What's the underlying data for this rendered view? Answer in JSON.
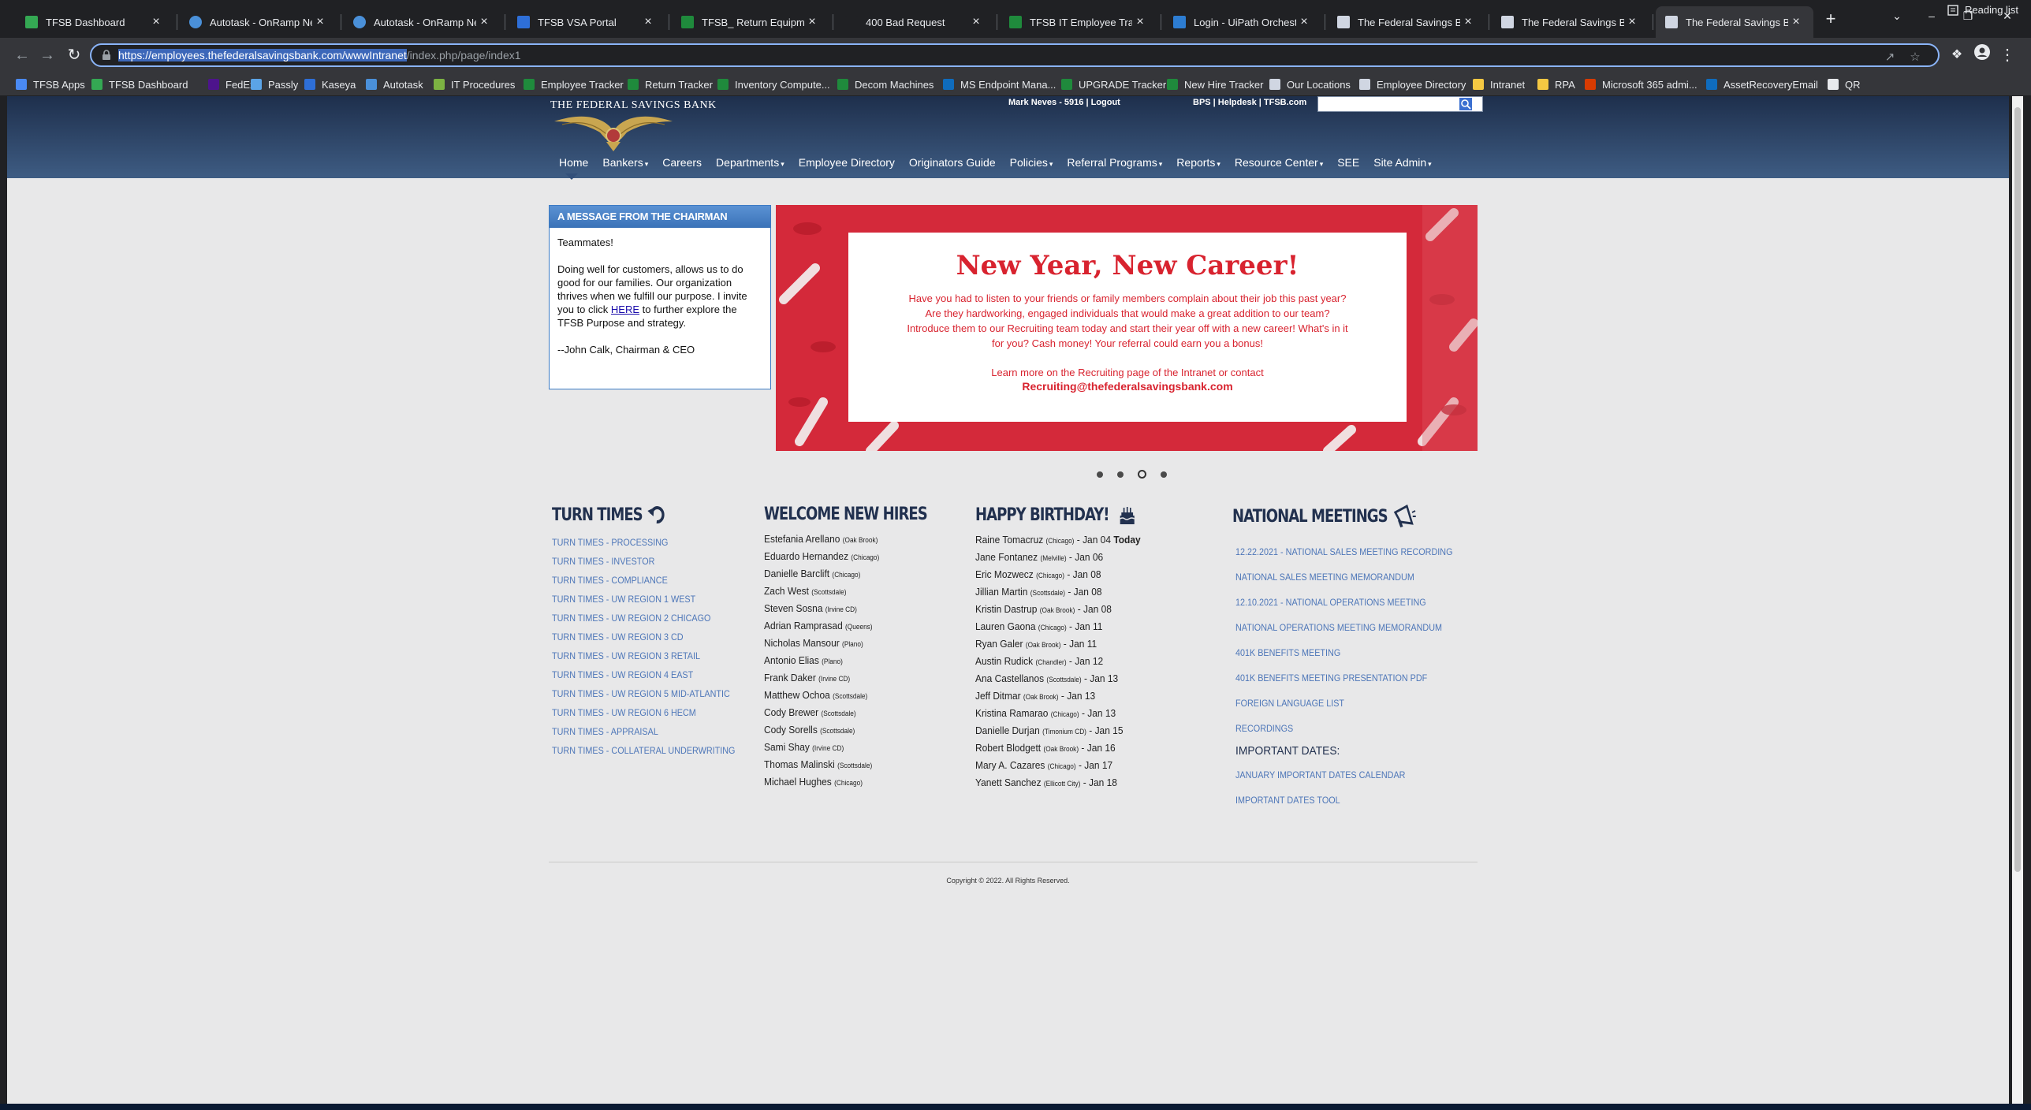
{
  "browser": {
    "tabs": [
      {
        "title": "TFSB Dashboard",
        "icon": "green-leaf-icon"
      },
      {
        "title": "Autotask - OnRamp Netwo",
        "icon": "autotask-icon"
      },
      {
        "title": "Autotask - OnRamp Netwo",
        "icon": "autotask-icon"
      },
      {
        "title": "TFSB VSA Portal",
        "icon": "kaseya-icon"
      },
      {
        "title": "TFSB_ Return Equipment Tr",
        "icon": "excel-icon"
      },
      {
        "title": "400 Bad Request",
        "icon": "blank-page-icon"
      },
      {
        "title": "TFSB IT Employee Tracker",
        "icon": "excel-icon"
      },
      {
        "title": "Login - UiPath Orchestrato",
        "icon": "uipath-icon"
      },
      {
        "title": "The Federal Savings Bank |",
        "icon": "tfsb-icon"
      },
      {
        "title": "The Federal Savings Bank |",
        "icon": "tfsb-icon"
      },
      {
        "title": "The Federal Savings Bank |",
        "icon": "tfsb-icon"
      }
    ],
    "active_tab": 10,
    "url_selected": "https://employees.thefederalsavingsbank.com/wwwIntranet",
    "url_rest": "/index.php/page/index1",
    "bookmarks": [
      {
        "label": "TFSB Apps",
        "icon": "apps-grid-icon"
      },
      {
        "label": "TFSB Dashboard",
        "icon": "green-leaf-icon"
      },
      {
        "label": "FedEx",
        "icon": "fedex-icon"
      },
      {
        "label": "Passly",
        "icon": "passly-icon"
      },
      {
        "label": "Kaseya",
        "icon": "kaseya-icon"
      },
      {
        "label": "Autotask",
        "icon": "autotask-icon"
      },
      {
        "label": "IT Procedures",
        "icon": "procedures-icon"
      },
      {
        "label": "Employee Tracker",
        "icon": "excel-icon"
      },
      {
        "label": "Return Tracker",
        "icon": "excel-icon"
      },
      {
        "label": "Inventory Compute...",
        "icon": "excel-icon"
      },
      {
        "label": "Decom Machines",
        "icon": "excel-icon"
      },
      {
        "label": "MS Endpoint Mana...",
        "icon": "endpoint-icon"
      },
      {
        "label": "UPGRADE Tracker",
        "icon": "excel-icon"
      },
      {
        "label": "New Hire Tracker",
        "icon": "excel-icon"
      },
      {
        "label": "Our Locations",
        "icon": "tfsb-icon"
      },
      {
        "label": "Employee Directory",
        "icon": "tfsb-icon"
      },
      {
        "label": "Intranet",
        "icon": "folder-icon"
      },
      {
        "label": "RPA",
        "icon": "folder-icon"
      },
      {
        "label": "Microsoft 365 admi...",
        "icon": "office-icon"
      },
      {
        "label": "AssetRecoveryEmail",
        "icon": "outlook-icon"
      },
      {
        "label": "QR",
        "icon": "qr-icon"
      }
    ],
    "reading_list": "Reading list"
  },
  "site": {
    "bank_name": "THE FEDERAL SAVINGS BANK",
    "user": "Mark Neves - 5916 | Logout",
    "util_links": "BPS | Helpdesk | TFSB.com",
    "nav": [
      "Home",
      "Bankers",
      "Careers",
      "Departments",
      "Employee Directory",
      "Originators Guide",
      "Policies",
      "Referral Programs",
      "Reports",
      "Resource Center",
      "SEE",
      "Site Admin"
    ],
    "nav_caret": "▾",
    "chairman": {
      "heading": "A MESSAGE FROM THE CHAIRMAN",
      "greeting": "Teammates!",
      "body_before": "Doing well for customers, allows us to do good for our families. Our organization thrives when we fulfill our purpose. I invite you to click ",
      "link": "HERE",
      "body_after": " to further explore the TFSB Purpose and strategy.",
      "signature": "--John Calk, Chairman & CEO"
    },
    "banner": {
      "title": "New Year, New Career!",
      "line1": "Have you had to listen to your friends or family members complain about their job this past year?",
      "line2": "Are they hardworking, engaged individuals that would make a great addition to our team?",
      "line3": "Introduce them to our Recruiting team today and start their year off with a new career! What's in it",
      "line4": "for you? Cash money! Your referral could earn you a bonus!",
      "learn": "Learn more on the Recruiting page of the Intranet or contact",
      "email": "Recruiting@thefederalsavingsbank.com"
    },
    "slides": {
      "count": 4,
      "active": 2
    },
    "turn_times": {
      "heading": "TURN TIMES",
      "links": [
        "TURN TIMES - PROCESSING",
        "TURN TIMES - INVESTOR",
        "TURN TIMES - COMPLIANCE",
        "TURN TIMES - UW REGION 1 WEST",
        "TURN TIMES - UW REGION 2 CHICAGO",
        "TURN TIMES - UW REGION 3 CD",
        "TURN TIMES - UW REGION 3 RETAIL",
        "TURN TIMES - UW REGION 4 EAST",
        "TURN TIMES - UW REGION 5 MID-ATLANTIC",
        "TURN TIMES - UW REGION 6 HECM",
        "TURN TIMES - APPRAISAL",
        "TURN TIMES - COLLATERAL UNDERWRITING"
      ]
    },
    "new_hires": {
      "heading": "WELCOME NEW HIRES",
      "people": [
        {
          "name": "Estefania Arellano",
          "loc": "(Oak Brook)"
        },
        {
          "name": "Eduardo Hernandez",
          "loc": "(Chicago)"
        },
        {
          "name": "Danielle Barclift",
          "loc": "(Chicago)"
        },
        {
          "name": "Zach West",
          "loc": "(Scottsdale)"
        },
        {
          "name": "Steven Sosna",
          "loc": "(Irvine CD)"
        },
        {
          "name": "Adrian Ramprasad",
          "loc": "(Queens)"
        },
        {
          "name": "Nicholas Mansour",
          "loc": "(Plano)"
        },
        {
          "name": "Antonio Elias",
          "loc": "(Plano)"
        },
        {
          "name": "Frank Daker",
          "loc": "(Irvine CD)"
        },
        {
          "name": "Matthew Ochoa",
          "loc": "(Scottsdale)"
        },
        {
          "name": "Cody Brewer",
          "loc": "(Scottsdale)"
        },
        {
          "name": "Cody Sorells",
          "loc": "(Scottsdale)"
        },
        {
          "name": "Sami Shay",
          "loc": "(Irvine CD)"
        },
        {
          "name": "Thomas Malinski",
          "loc": "(Scottsdale)"
        },
        {
          "name": "Michael Hughes",
          "loc": "(Chicago)"
        }
      ]
    },
    "birthdays": {
      "heading": "HAPPY BIRTHDAY!",
      "today_label": "Today",
      "people": [
        {
          "name": "Raine Tomacruz",
          "loc": "(Chicago)",
          "date": "- Jan 04"
        },
        {
          "name": "Jane Fontanez",
          "loc": "(Melville)",
          "date": "- Jan 06"
        },
        {
          "name": "Eric Mozwecz",
          "loc": "(Chicago)",
          "date": "- Jan 08"
        },
        {
          "name": "Jillian Martin",
          "loc": "(Scottsdale)",
          "date": "- Jan 08"
        },
        {
          "name": "Kristin Dastrup",
          "loc": "(Oak Brook)",
          "date": "- Jan 08"
        },
        {
          "name": "Lauren Gaona",
          "loc": "(Chicago)",
          "date": "- Jan 11"
        },
        {
          "name": "Ryan Galer",
          "loc": "(Oak Brook)",
          "date": "- Jan 11"
        },
        {
          "name": "Austin Rudick",
          "loc": "(Chandler)",
          "date": "- Jan 12"
        },
        {
          "name": "Ana Castellanos",
          "loc": "(Scottsdale)",
          "date": "- Jan 13"
        },
        {
          "name": "Jeff Ditmar",
          "loc": "(Oak Brook)",
          "date": "- Jan 13"
        },
        {
          "name": "Kristina Ramarao",
          "loc": "(Chicago)",
          "date": "- Jan 13"
        },
        {
          "name": "Danielle Durjan",
          "loc": "(Timonium CD)",
          "date": "- Jan 15"
        },
        {
          "name": "Robert Blodgett",
          "loc": "(Oak Brook)",
          "date": "- Jan 16"
        },
        {
          "name": "Mary A. Cazares",
          "loc": "(Chicago)",
          "date": "- Jan 17"
        },
        {
          "name": "Yanett Sanchez",
          "loc": "(Ellicott City)",
          "date": "- Jan 18"
        }
      ]
    },
    "meetings": {
      "heading": "NATIONAL MEETINGS",
      "links": [
        "12.22.2021 - NATIONAL SALES MEETING RECORDING",
        "NATIONAL SALES MEETING MEMORANDUM",
        "12.10.2021 - NATIONAL OPERATIONS MEETING",
        "NATIONAL OPERATIONS MEETING MEMORANDUM",
        "401K BENEFITS MEETING",
        "401K BENEFITS MEETING PRESENTATION PDF",
        "FOREIGN LANGUAGE LIST",
        "RECORDINGS"
      ],
      "important_heading": "IMPORTANT DATES:",
      "important_links": [
        "JANUARY IMPORTANT DATES CALENDAR",
        "IMPORTANT DATES TOOL"
      ]
    },
    "copyright": "Copyright © 2022. All Rights Reserved."
  },
  "colors": {
    "brand_navy": "#22314f",
    "link_blue": "#4d76b8",
    "banner_red": "#d8232f",
    "header_dark": "#1e2f4c"
  }
}
